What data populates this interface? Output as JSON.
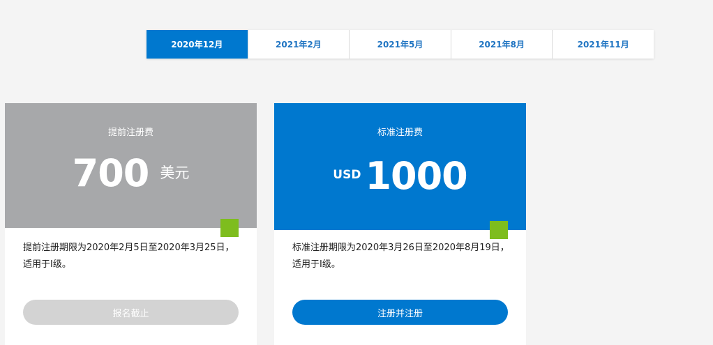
{
  "tabs": [
    {
      "label": "2020年12月",
      "active": true
    },
    {
      "label": "2021年2月",
      "active": false
    },
    {
      "label": "2021年5月",
      "active": false
    },
    {
      "label": "2021年8月",
      "active": false
    },
    {
      "label": "2021年11月",
      "active": false
    }
  ],
  "early_card": {
    "title": "提前注册费",
    "amount": "700",
    "unit": "美元",
    "description": "提前注册期限为2020年2月5日至2020年3月25日，适用于I级。",
    "button_label": "报名截止"
  },
  "standard_card": {
    "title": "标准注册费",
    "unit": "USD",
    "amount": "1000",
    "description": "标准注册期限为2020年3月26日至2020年8月19日，适用于I级。",
    "button_label": "注册并注册"
  },
  "colors": {
    "accent_blue": "#0078cf",
    "muted_gray": "#a7a8aa",
    "green_marker": "#7ebd1e"
  }
}
